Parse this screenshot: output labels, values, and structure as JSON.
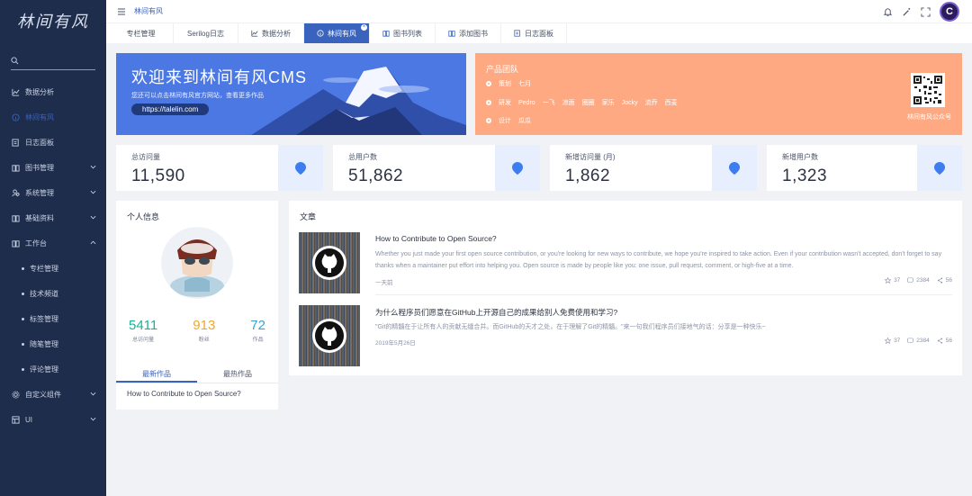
{
  "sidebar": {
    "logo": "林间有风",
    "search_placeholder": "",
    "items": [
      {
        "label": "数据分析",
        "icon": "chart-line-icon"
      },
      {
        "label": "林间有风",
        "icon": "info-circle-icon",
        "active": true
      },
      {
        "label": "日志面板",
        "icon": "edit-note-icon"
      },
      {
        "label": "图书管理",
        "icon": "book-icon",
        "expand": true
      },
      {
        "label": "系统管理",
        "icon": "users-icon",
        "expand": true
      },
      {
        "label": "基础资料",
        "icon": "book-icon",
        "expand": true
      },
      {
        "label": "工作台",
        "icon": "book-icon",
        "expand": true,
        "open": true
      }
    ],
    "sub_items": [
      "专栏管理",
      "技术频道",
      "标签管理",
      "随笔管理",
      "评论管理"
    ],
    "bottom_items": [
      {
        "label": "自定义组件",
        "icon": "gear-icon",
        "expand": true
      },
      {
        "label": "UI",
        "icon": "grid-icon",
        "expand": true
      }
    ]
  },
  "header": {
    "breadcrumb": "林间有风",
    "avatar_letter": "C"
  },
  "tabs": [
    {
      "label": "专栏管理",
      "icon": ""
    },
    {
      "label": "Serilog日志",
      "icon": ""
    },
    {
      "label": "数据分析",
      "icon": "chart-line-icon"
    },
    {
      "label": "林间有风",
      "icon": "info-circle-icon",
      "active": true
    },
    {
      "label": "图书列表",
      "icon": "book-icon"
    },
    {
      "label": "添加图书",
      "icon": "book-icon"
    },
    {
      "label": "日志面板",
      "icon": "edit-note-icon"
    }
  ],
  "welcome": {
    "title": "欢迎来到林间有风CMS",
    "subtitle": "您还可以点击林间有风官方网站，查看更多作品",
    "link": "https://talelin.com"
  },
  "team": {
    "title": "产品团队",
    "rows": [
      {
        "role": "策划",
        "members": [
          "七月"
        ]
      },
      {
        "role": "研发",
        "members": [
          "Pedro",
          "一飞",
          "凉面",
          "圈圈",
          "家乐",
          "Jocky",
          "流乔",
          "西麦"
        ]
      },
      {
        "role": "设计",
        "members": [
          "瓜瓜"
        ]
      }
    ],
    "qr_label": "林间有风公众号"
  },
  "stats": [
    {
      "label": "总访问量",
      "value": "11,590"
    },
    {
      "label": "总用户数",
      "value": "51,862"
    },
    {
      "label": "新增访问量 (月)",
      "value": "1,862"
    },
    {
      "label": "新增用户数",
      "value": "1,323"
    }
  ],
  "profile": {
    "title": "个人信息",
    "stats": [
      {
        "value": "5411",
        "label": "总访问量",
        "color": "#19b394"
      },
      {
        "value": "913",
        "label": "粉丝",
        "color": "#f5a623"
      },
      {
        "value": "72",
        "label": "作品",
        "color": "#3b9fd8"
      }
    ],
    "tabs": [
      "最新作品",
      "最热作品"
    ],
    "list": [
      "How to Contribute to Open Source?"
    ]
  },
  "articles": {
    "title": "文章",
    "items": [
      {
        "title": "How to Contribute to Open Source?",
        "desc": "Whether you just made your first open source contribution, or you're looking for new ways to contribute, we hope you're inspired to take action. Even if your contribution wasn't accepted, don't forget to say thanks when a maintainer put effort into helping you. Open source is made by people like you: one issue, pull request, comment, or high-five at a time.",
        "date": "一天前",
        "stars": "37",
        "comments": "2384",
        "shares": "56"
      },
      {
        "title": "为什么程序员们愿意在GitHub上开源自己的成果给别人免费使用和学习?",
        "desc": "\"Git的精髓在于让所有人的贡献无缝合并。而GitHub的天才之处，在于理解了Git的精髓。\"来一句我们程序员们接地气的话：分享是一种快乐~",
        "date": "2019年5月26日",
        "stars": "37",
        "comments": "2384",
        "shares": "56"
      }
    ]
  },
  "colors": {
    "sidebar_bg": "#1f2d4d",
    "primary": "#3963bc",
    "welcome_bg": "#4c78e4",
    "team_bg": "#ffa983"
  }
}
